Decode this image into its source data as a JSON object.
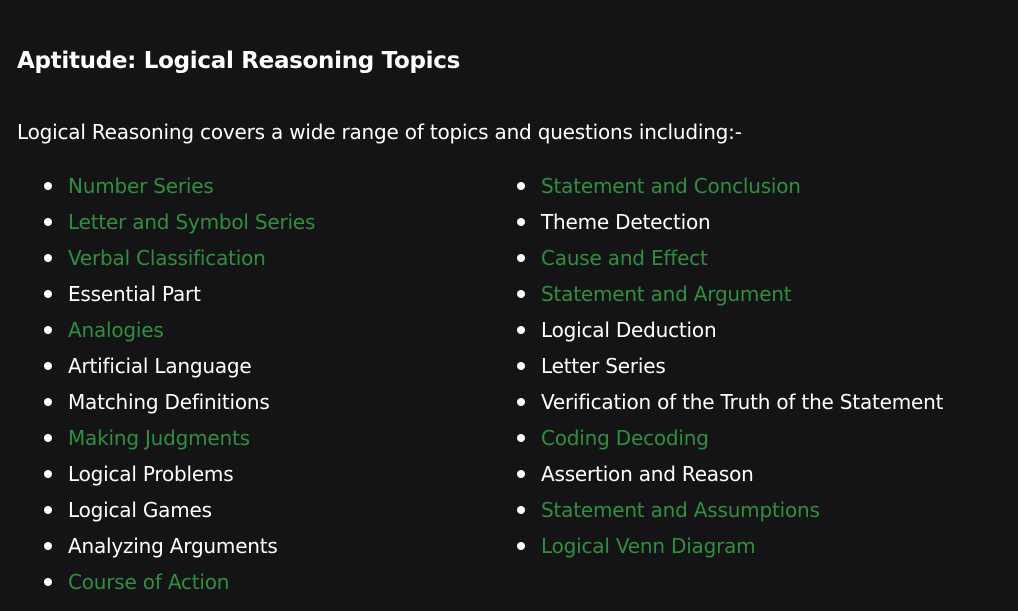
{
  "article": {
    "title": "Aptitude: Logical Reasoning Topics",
    "intro": "Logical Reasoning covers a wide range of topics and questions including:-",
    "colors": {
      "background": "#141416",
      "text": "#ffffff",
      "link": "#2f8f3e"
    },
    "left_topics": [
      {
        "label": "Number Series",
        "link": true
      },
      {
        "label": "Letter and Symbol Series",
        "link": true
      },
      {
        "label": "Verbal Classification",
        "link": true
      },
      {
        "label": "Essential Part",
        "link": false
      },
      {
        "label": "Analogies",
        "link": true
      },
      {
        "label": "Artificial Language",
        "link": false
      },
      {
        "label": "Matching Definitions",
        "link": false
      },
      {
        "label": "Making Judgments",
        "link": true
      },
      {
        "label": "Logical Problems",
        "link": false
      },
      {
        "label": "Logical Games",
        "link": false
      },
      {
        "label": "Analyzing Arguments",
        "link": false
      },
      {
        "label": "Course of Action",
        "link": true
      }
    ],
    "right_topics": [
      {
        "label": "Statement and Conclusion",
        "link": true
      },
      {
        "label": "Theme Detection",
        "link": false
      },
      {
        "label": "Cause and Effect",
        "link": true
      },
      {
        "label": "Statement and Argument",
        "link": true
      },
      {
        "label": "Logical Deduction",
        "link": false
      },
      {
        "label": "Letter Series",
        "link": false
      },
      {
        "label": "Verification of the Truth of the Statement",
        "link": false
      },
      {
        "label": "Coding Decoding",
        "link": true
      },
      {
        "label": "Assertion and Reason",
        "link": false
      },
      {
        "label": "Statement and Assumptions",
        "link": true
      },
      {
        "label": "Logical Venn Diagram",
        "link": true
      }
    ]
  }
}
